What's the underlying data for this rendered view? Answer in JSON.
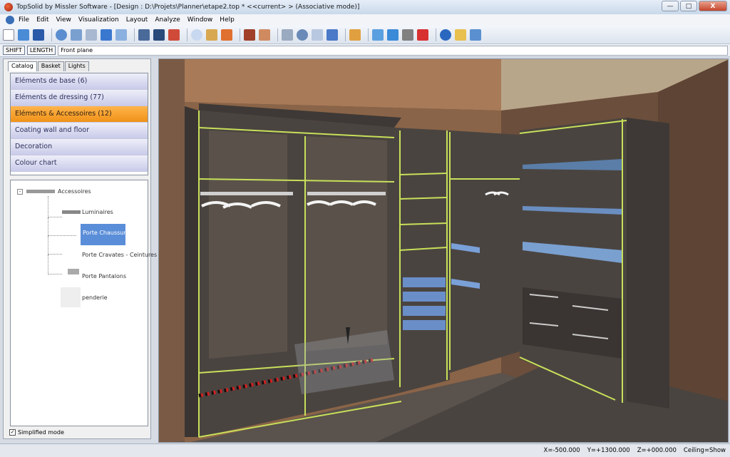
{
  "window": {
    "title": "TopSolid by Missler Software - [Design : D:\\Projets\\Planner\\etape2.top *  <<current> > (Associative mode)]",
    "min": "—",
    "max": "□",
    "close": "X"
  },
  "menu": [
    "File",
    "Edit",
    "View",
    "Visualization",
    "Layout",
    "Analyze",
    "Window",
    "Help"
  ],
  "cmd": {
    "shift": "SHIFT",
    "length": "LENGTH",
    "plane": "Front plane"
  },
  "tabs": [
    "Catalog",
    "Basket",
    "Lights"
  ],
  "catalog": [
    {
      "label": "Eléments de base (6)"
    },
    {
      "label": "Eléments de dressing (77)"
    },
    {
      "label": "Eléments & Accessoires (12)"
    },
    {
      "label": "Coating wall and floor"
    },
    {
      "label": "Decoration"
    },
    {
      "label": "Colour chart"
    }
  ],
  "tree": {
    "root": "Accessoires",
    "items": [
      "Luminaires",
      "Porte Chaussures",
      "Porte Cravates - Ceintures",
      "Porte Pantalons",
      "penderie"
    ]
  },
  "simplified": "Simplified mode",
  "status": {
    "x": "X=-500.000",
    "y": "Y=+1300.000",
    "z": "Z=+000.000",
    "ceiling": "Ceiling=Show"
  },
  "colors": {
    "accent": "#f5a030",
    "edge": "#c8e05a",
    "wood": "#4a4440"
  },
  "icons": [
    "new-icon",
    "add-icon",
    "save-icon",
    "undo-icon",
    "cylinder-icon",
    "wrench-icon",
    "move-icon",
    "copy-icon",
    "measure-icon",
    "glasses-icon",
    "assembly-icon",
    "zoom-icon",
    "box-icon",
    "arrow-icon",
    "brick-icon",
    "texture-icon",
    "eye-icon",
    "sphere-icon",
    "cube-icon",
    "window-icon",
    "grid-icon",
    "stone-icon",
    "delete-icon",
    "globe-icon",
    "folder-icon",
    "bag-icon"
  ]
}
